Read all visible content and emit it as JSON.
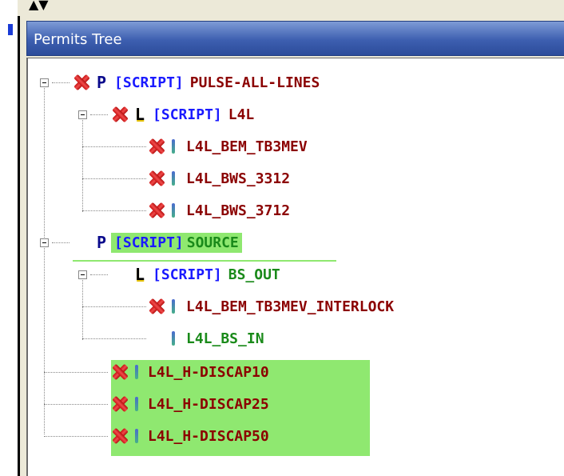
{
  "window": {
    "title": "Permits Tree"
  },
  "tree": {
    "nodes": [
      {
        "id": "pulse",
        "type": "P",
        "tag": "[SCRIPT]",
        "name": "PULSE-ALL-LINES",
        "status": "fail"
      },
      {
        "id": "l4l",
        "type": "L",
        "tag": "[SCRIPT]",
        "name": "L4L",
        "status": "fail"
      },
      {
        "id": "bem",
        "type": "I",
        "name": "L4L_BEM_TB3MEV",
        "status": "fail"
      },
      {
        "id": "bws3312",
        "type": "I",
        "name": "L4L_BWS_3312",
        "status": "fail"
      },
      {
        "id": "bws3712",
        "type": "I",
        "name": "L4L_BWS_3712",
        "status": "fail"
      },
      {
        "id": "source",
        "type": "P",
        "tag": "[SCRIPT]",
        "name": "SOURCE",
        "status": "ok"
      },
      {
        "id": "bsout",
        "type": "L",
        "tag": "[SCRIPT]",
        "name": "BS_OUT",
        "status": "ok"
      },
      {
        "id": "interlock",
        "type": "I",
        "name": "L4L_BEM_TB3MEV_INTERLOCK",
        "status": "fail"
      },
      {
        "id": "bsin",
        "type": "I",
        "name": "L4L_BS_IN",
        "status": "ok"
      },
      {
        "id": "hd10",
        "type": "I",
        "name": "L4L_H-DISCAP10",
        "status": "fail"
      },
      {
        "id": "hd25",
        "type": "I",
        "name": "L4L_H-DISCAP25",
        "status": "fail"
      },
      {
        "id": "hd50",
        "type": "I",
        "name": "L4L_H-DISCAP50",
        "status": "fail"
      }
    ]
  },
  "colors": {
    "fail_text": "#8b0000",
    "ok_text": "#1a8a1a",
    "script_tag": "#1a1aff",
    "highlight": "#8fe870",
    "titlebar": "#3d5fb0"
  },
  "icons": {
    "fail": "red-x-icon",
    "P": "permit-p-icon",
    "L": "line-l-icon",
    "I": "interlock-bar-icon",
    "expander": "collapse-minus-icon"
  }
}
